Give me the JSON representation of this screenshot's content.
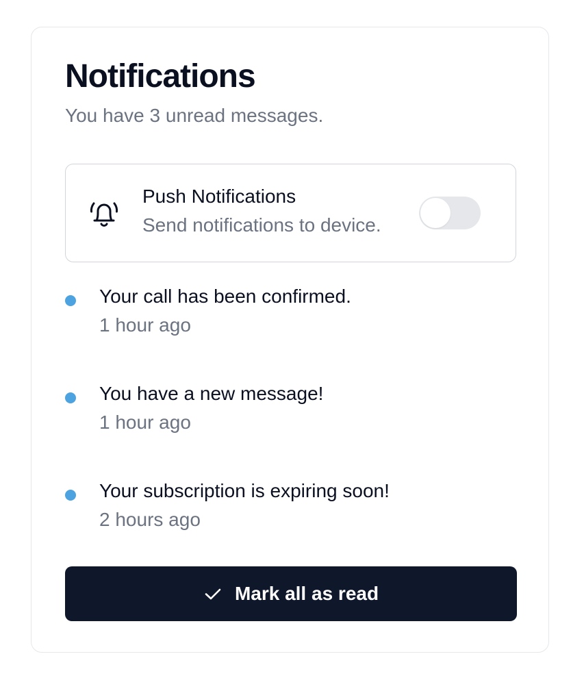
{
  "card": {
    "title": "Notifications",
    "subtitle": "You have 3 unread messages."
  },
  "push": {
    "icon": "bell-ringing-icon",
    "title": "Push Notifications",
    "description": "Send notifications to device.",
    "enabled": false
  },
  "notifications": [
    {
      "message": "Your call has been confirmed.",
      "time": "1 hour ago",
      "unread": true
    },
    {
      "message": "You have a new message!",
      "time": "1 hour ago",
      "unread": true
    },
    {
      "message": "Your subscription is expiring soon!",
      "time": "2 hours ago",
      "unread": true
    }
  ],
  "button": {
    "icon": "check-icon",
    "label": "Mark all as read"
  },
  "colors": {
    "unread_dot": "#4da3e0",
    "button_bg": "#0f172a",
    "muted_text": "#6b7280",
    "primary_text": "#0b1020",
    "toggle_off": "#e5e7eb"
  }
}
